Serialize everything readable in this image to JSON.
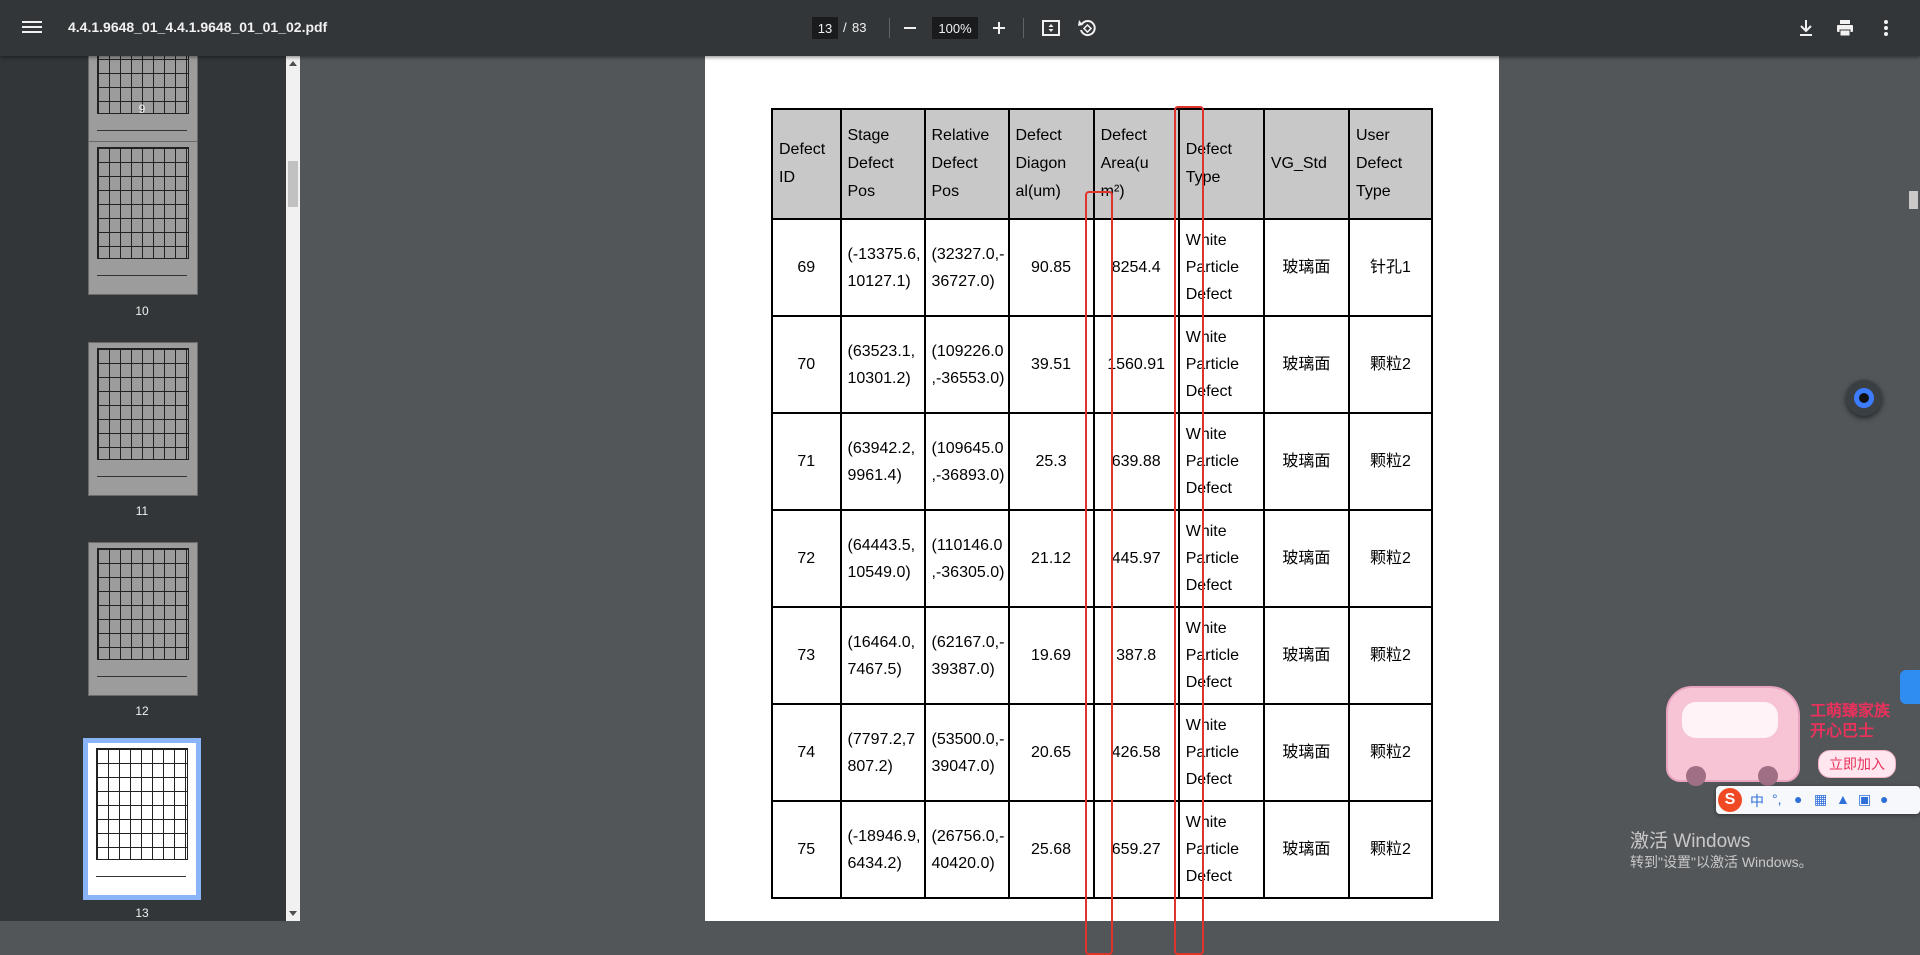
{
  "toolbar": {
    "file_name": "4.4.1.9648_01_4.4.1.9648_01_01_02.pdf",
    "current_page": "13",
    "page_separator": "/",
    "total_pages": "83",
    "zoom": "100%",
    "icons": [
      "menu-icon",
      "zoom-out-icon",
      "zoom-in-icon",
      "fit-page-icon",
      "rotate-icon",
      "download-icon",
      "print-icon",
      "more-vert-icon"
    ]
  },
  "sidebar": {
    "thumbnails": [
      {
        "label": "9"
      },
      {
        "label": "10"
      },
      {
        "label": "11"
      },
      {
        "label": "12"
      },
      {
        "label": "13",
        "active": true
      }
    ]
  },
  "table": {
    "headers": [
      "Defect ID",
      "Stage Defect Pos",
      "Relative Defect Pos",
      "Defect Diagon al(um)",
      "Defect Area(u m²)",
      "Defect Type",
      "VG_Std",
      "User Defect Type"
    ],
    "header_lines": [
      [
        "Defect",
        "ID"
      ],
      [
        "Stage",
        "Defect",
        "Pos"
      ],
      [
        "Relative",
        "Defect",
        "Pos"
      ],
      [
        "Defect",
        "Diagon",
        "al(um)"
      ],
      [
        "Defect",
        "Area(u",
        "m²)"
      ],
      [
        "Defect",
        "Type"
      ],
      [
        "VG_Std"
      ],
      [
        "User",
        "Defect",
        "Type"
      ]
    ],
    "rows": [
      {
        "id": "69",
        "stage_l1": "(-13375.6,",
        "stage_l2": "10127.1)",
        "rel_l1": "(32327.0,-",
        "rel_l2": "36727.0)",
        "diag": "90.85",
        "area": "8254.4",
        "type_l1": "White",
        "type_l2": "Particle",
        "type_l3": "Defect",
        "vg": "玻璃面",
        "user": "针孔1"
      },
      {
        "id": "70",
        "stage_l1": "(63523.1,",
        "stage_l2": "10301.2)",
        "rel_l1": "(109226.0",
        "rel_l2": ",-36553.0)",
        "diag": "39.51",
        "area": "1560.91",
        "type_l1": "White",
        "type_l2": "Particle",
        "type_l3": "Defect",
        "vg": "玻璃面",
        "user": "颗粒2"
      },
      {
        "id": "71",
        "stage_l1": "(63942.2,",
        "stage_l2": "9961.4)",
        "rel_l1": "(109645.0",
        "rel_l2": ",-36893.0)",
        "diag": "25.3",
        "area": "639.88",
        "type_l1": "White",
        "type_l2": "Particle",
        "type_l3": "Defect",
        "vg": "玻璃面",
        "user": "颗粒2"
      },
      {
        "id": "72",
        "stage_l1": "(64443.5,",
        "stage_l2": "10549.0)",
        "rel_l1": "(110146.0",
        "rel_l2": ",-36305.0)",
        "diag": "21.12",
        "area": "445.97",
        "type_l1": "White",
        "type_l2": "Particle",
        "type_l3": "Defect",
        "vg": "玻璃面",
        "user": "颗粒2"
      },
      {
        "id": "73",
        "stage_l1": "(16464.0,",
        "stage_l2": "7467.5)",
        "rel_l1": "(62167.0,-",
        "rel_l2": "39387.0)",
        "diag": "19.69",
        "area": "387.8",
        "type_l1": "White",
        "type_l2": "Particle",
        "type_l3": "Defect",
        "vg": "玻璃面",
        "user": "颗粒2"
      },
      {
        "id": "74",
        "stage_l1": "(7797.2,7",
        "stage_l2": "807.2)",
        "rel_l1": "(53500.0,-",
        "rel_l2": "39047.0)",
        "diag": "20.65",
        "area": "426.58",
        "type_l1": "White",
        "type_l2": "Particle",
        "type_l3": "Defect",
        "vg": "玻璃面",
        "user": "颗粒2"
      },
      {
        "id": "75",
        "stage_l1": "(-18946.9,",
        "stage_l2": "6434.2)",
        "rel_l1": "(26756.0,-",
        "rel_l2": "40420.0)",
        "diag": "25.68",
        "area": "659.27",
        "type_l1": "White",
        "type_l2": "Particle",
        "type_l3": "Defect",
        "vg": "玻璃面",
        "user": "颗粒2"
      }
    ]
  },
  "annotations": {
    "highlight_color": "#e0332c"
  },
  "overlay": {
    "promo_line1": "工萌臻家族",
    "promo_line2": "开心巴士",
    "promo_join": "立即加入",
    "ime_logo": "S",
    "ime_mode": "中",
    "ime_punct": "°,",
    "watermark_title": "激活 Windows",
    "watermark_sub": "转到\"设置\"以激活 Windows。"
  },
  "colors": {
    "toolbar_bg": "#323639",
    "viewer_bg": "#525659",
    "active_thumb_border": "#8ab4f8",
    "table_header_bg": "#c8c8c8"
  }
}
